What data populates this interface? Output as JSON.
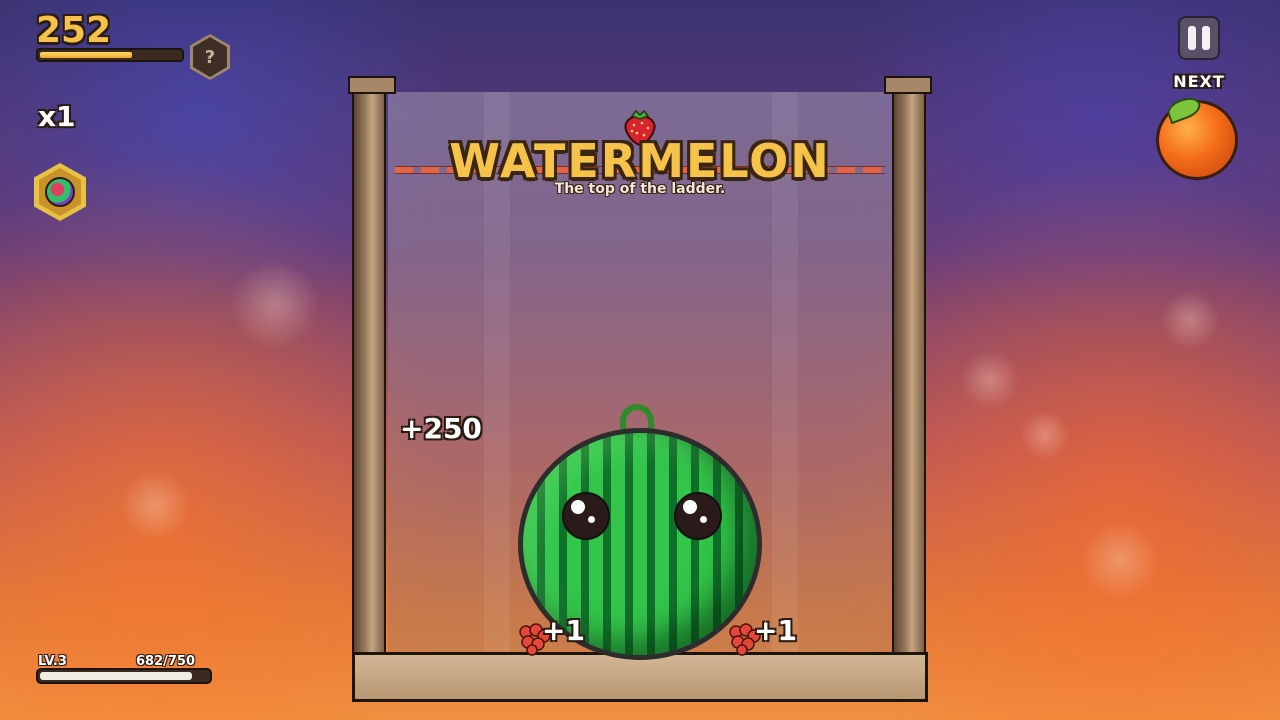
{
  "hud": {
    "score": "252",
    "score_progress": 0.67,
    "help_label": "?",
    "multiplier": "x1",
    "level_label": "LV.3",
    "xp_text": "682/750",
    "xp_progress": 0.909
  },
  "next": {
    "label": "NEXT",
    "fruit_icon": "orange-icon"
  },
  "banner": {
    "title": "WATERMELON",
    "subtitle": "The top of the ladder."
  },
  "popups": {
    "points": "+250",
    "left_bonus": "+1",
    "right_bonus": "+1"
  },
  "colors": {
    "score_gold": "#f7c24a",
    "danger_line": "#e0664a",
    "melon_green": "#32c54a"
  }
}
